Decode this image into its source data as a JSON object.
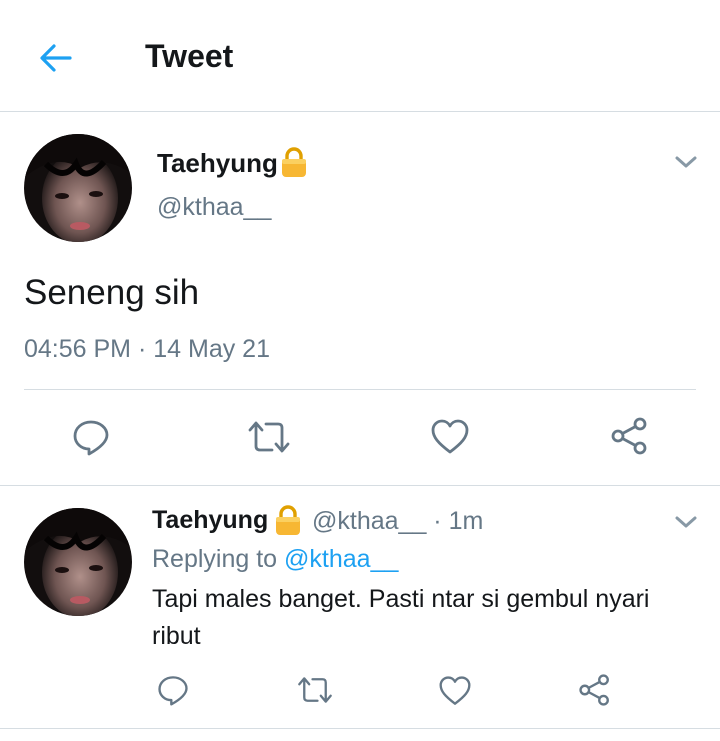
{
  "header": {
    "title": "Tweet",
    "accent": "#1da1f2"
  },
  "main_tweet": {
    "name": "Taehyung",
    "handle": "@kthaa__",
    "text": "Seneng sih",
    "time": "04:56 PM",
    "separator": "·",
    "date": "14 May 21",
    "icons": [
      "lock-icon",
      "chevron-down-icon",
      "reply-icon",
      "retweet-icon",
      "like-icon",
      "share-icon"
    ]
  },
  "reply_tweet": {
    "name": "Taehyung",
    "handle": "@kthaa__",
    "separator": "·",
    "age": "1m",
    "replying_prefix": "Replying to",
    "replying_handle": "@kthaa__",
    "text": "Tapi males banget. Pasti ntar si gembul nyari ribut"
  },
  "colors": {
    "text": "#14171a",
    "secondary": "#657786",
    "divider": "#d6dde2",
    "link": "#1da1f2",
    "lock": "#f4a524"
  }
}
